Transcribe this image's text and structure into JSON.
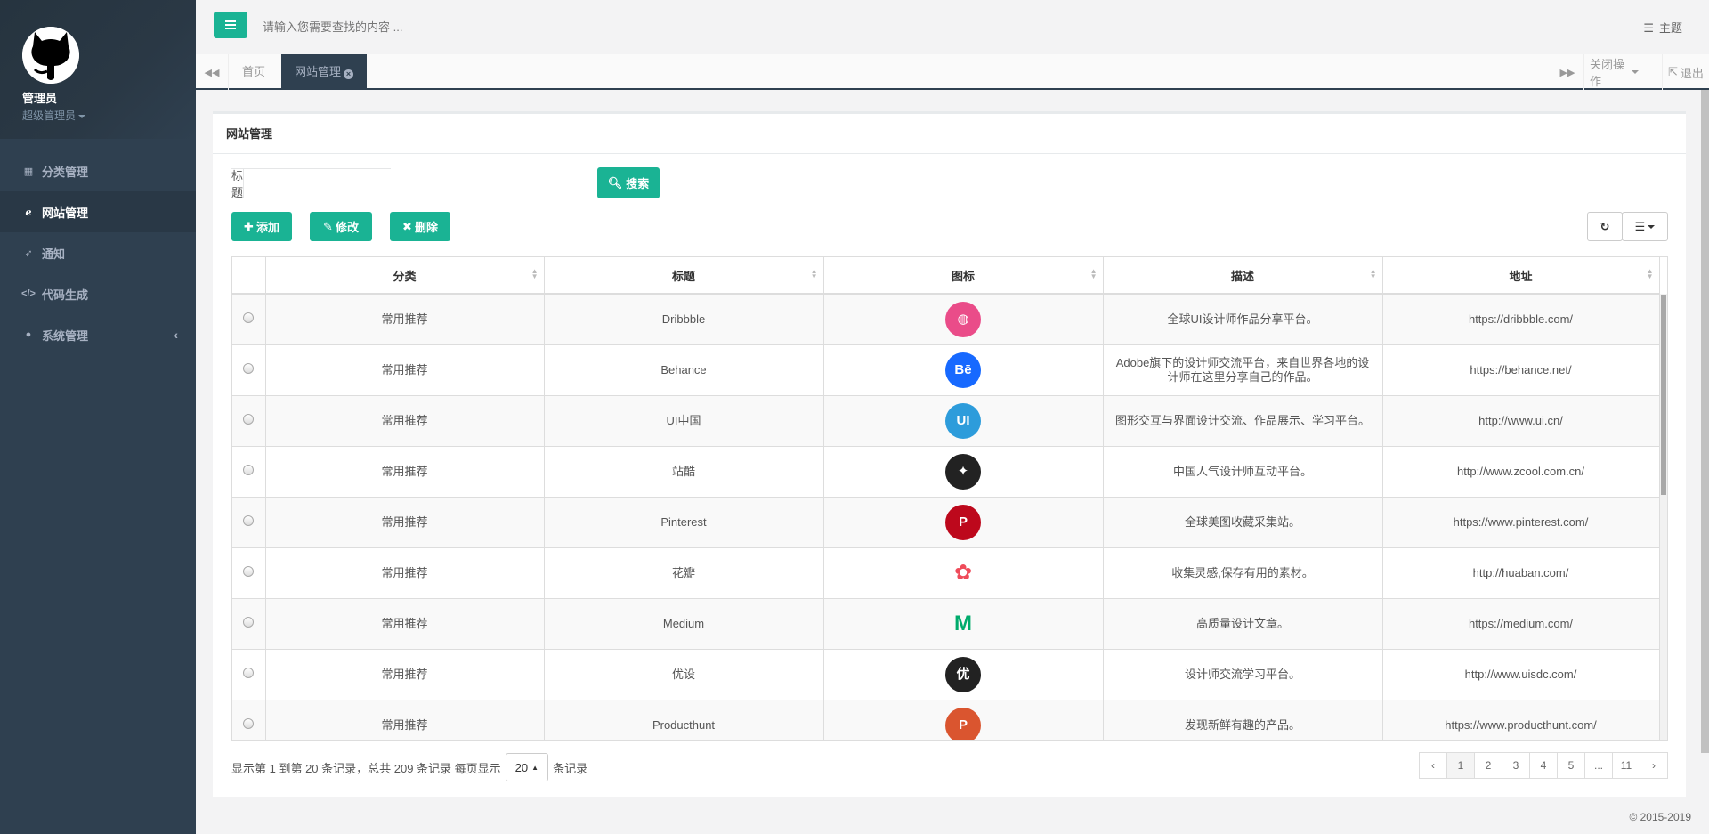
{
  "sidebar": {
    "profile_name": "管理员",
    "profile_role": "超级管理员",
    "items": [
      {
        "label": "分类管理",
        "icon": "table-icon"
      },
      {
        "label": "网站管理",
        "icon": "ie-icon"
      },
      {
        "label": "通知",
        "icon": "rocket-icon"
      },
      {
        "label": "代码生成",
        "icon": "code-icon"
      },
      {
        "label": "系统管理",
        "icon": "user-icon"
      }
    ]
  },
  "header": {
    "search_placeholder": "请输入您需要查找的内容 ...",
    "theme_label": "主题"
  },
  "tabs": {
    "home": "首页",
    "active": "网站管理",
    "close_ops": "关闭操作",
    "logout": "退出"
  },
  "panel": {
    "title": "网站管理",
    "filter_label": "标题",
    "search_button": "搜索",
    "add_button": "添加",
    "edit_button": "修改",
    "delete_button": "删除"
  },
  "table": {
    "columns": [
      "分类",
      "标题",
      "图标",
      "描述",
      "地址"
    ],
    "rows": [
      {
        "category": "常用推荐",
        "title": "Dribbble",
        "icon": "dribbble-icon",
        "icon_color": "#ea4c89",
        "desc": "全球UI设计师作品分享平台。",
        "url": "https://dribbble.com/"
      },
      {
        "category": "常用推荐",
        "title": "Behance",
        "icon": "behance-icon",
        "icon_color": "#1769ff",
        "desc": "Adobe旗下的设计师交流平台，来自世界各地的设计师在这里分享自己的作品。",
        "url": "https://behance.net/"
      },
      {
        "category": "常用推荐",
        "title": "UI中国",
        "icon": "uichina-icon",
        "icon_color": "#2d9cdb",
        "desc": "图形交互与界面设计交流、作品展示、学习平台。",
        "url": "http://www.ui.cn/"
      },
      {
        "category": "常用推荐",
        "title": "站酷",
        "icon": "zcool-icon",
        "icon_color": "#222222",
        "desc": "中国人气设计师互动平台。",
        "url": "http://www.zcool.com.cn/"
      },
      {
        "category": "常用推荐",
        "title": "Pinterest",
        "icon": "pinterest-icon",
        "icon_color": "#bd081c",
        "desc": "全球美图收藏采集站。",
        "url": "https://www.pinterest.com/"
      },
      {
        "category": "常用推荐",
        "title": "花瓣",
        "icon": "huaban-icon",
        "icon_color": "#ef4b5a",
        "desc": "收集灵感,保存有用的素材。",
        "url": "http://huaban.com/"
      },
      {
        "category": "常用推荐",
        "title": "Medium",
        "icon": "medium-icon",
        "icon_color": "#00ab6c",
        "desc": "高质量设计文章。",
        "url": "https://medium.com/"
      },
      {
        "category": "常用推荐",
        "title": "优设",
        "icon": "uisdc-icon",
        "icon_color": "#222222",
        "desc": "设计师交流学习平台。",
        "url": "http://www.uisdc.com/"
      },
      {
        "category": "常用推荐",
        "title": "Producthunt",
        "icon": "producthunt-icon",
        "icon_color": "#da552f",
        "desc": "发现新鲜有趣的产品。",
        "url": "https://www.producthunt.com/"
      }
    ]
  },
  "pagination": {
    "info_prefix": "显示第 1 到第 20 条记录，总共 209 条记录 每页显示",
    "page_size": "20",
    "info_suffix": "条记录",
    "pages": [
      "‹",
      "1",
      "2",
      "3",
      "4",
      "5",
      "...",
      "11",
      "›"
    ],
    "current": "1"
  },
  "footer": {
    "copyright": "© 2015-2019"
  }
}
